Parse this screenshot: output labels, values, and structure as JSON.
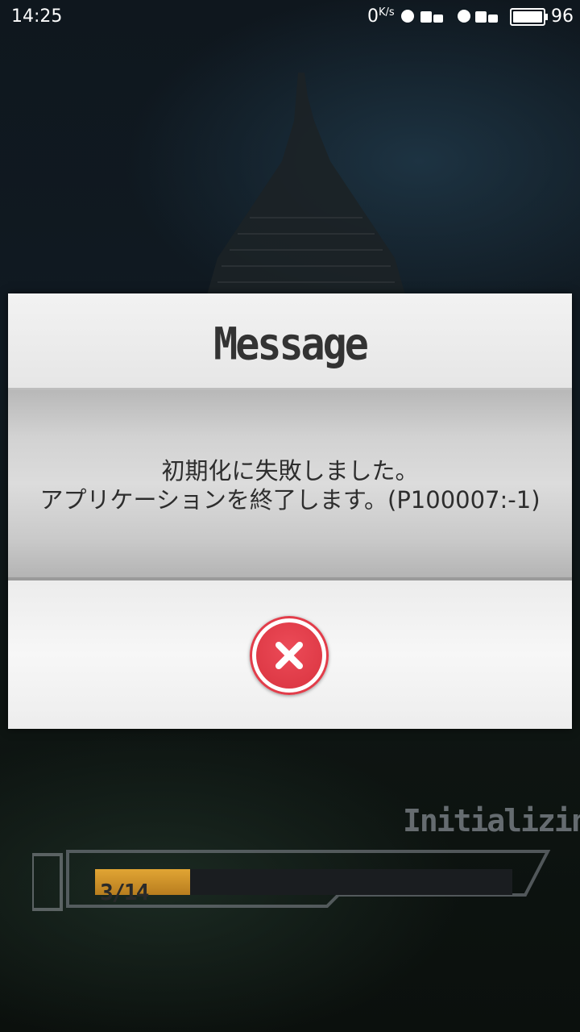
{
  "status_bar": {
    "time": "14:25",
    "net_speed": "0",
    "net_unit": "K/s",
    "battery": "96"
  },
  "dialog": {
    "title": "Message",
    "message_line1": "初期化に失敗しました。",
    "message_line2": "アプリケーションを終了します。(P100007:-1)",
    "close_icon": "close-x-icon",
    "accent": "#e23d4a"
  },
  "loading": {
    "label": "Initializing",
    "progress_text": "3/14",
    "progress_fraction": 0.2143
  }
}
